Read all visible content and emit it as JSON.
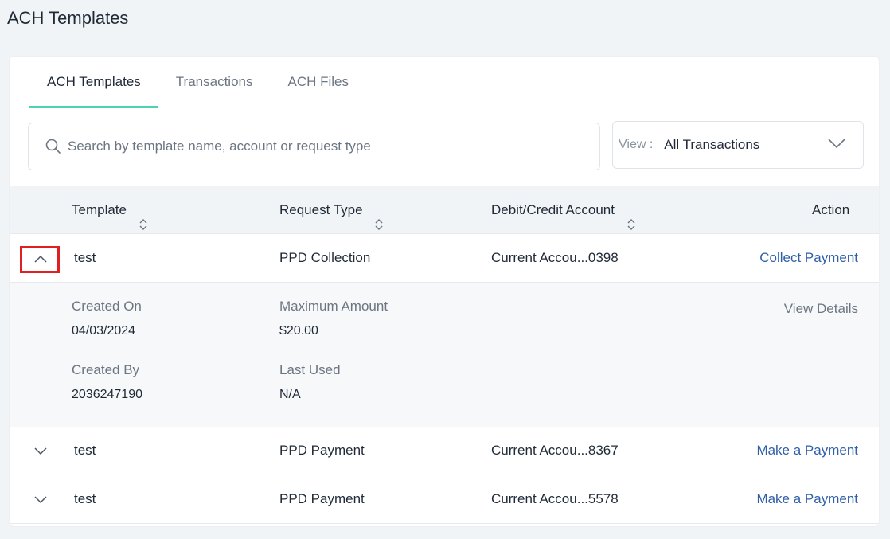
{
  "page": {
    "title": "ACH Templates"
  },
  "tabs": [
    {
      "label": "ACH Templates",
      "active": true
    },
    {
      "label": "Transactions",
      "active": false
    },
    {
      "label": "ACH Files",
      "active": false
    }
  ],
  "search": {
    "placeholder": "Search by template name, account or request type",
    "value": ""
  },
  "view": {
    "label": "View :",
    "value": "All Transactions"
  },
  "table": {
    "columns": {
      "template": "Template",
      "request_type": "Request Type",
      "account": "Debit/Credit Account",
      "action": "Action"
    },
    "rows": [
      {
        "template": "test",
        "request_type": "PPD Collection",
        "account": "Current Accou...0398",
        "action": "Collect Payment",
        "expanded": true
      },
      {
        "template": "test",
        "request_type": "PPD Payment",
        "account": "Current Accou...8367",
        "action": "Make a Payment",
        "expanded": false
      },
      {
        "template": "test",
        "request_type": "PPD Payment",
        "account": "Current Accou...5578",
        "action": "Make a Payment",
        "expanded": false
      }
    ],
    "detail": {
      "created_on_label": "Created On",
      "created_on": "04/03/2024",
      "created_by_label": "Created By",
      "created_by": "2036247190",
      "max_amount_label": "Maximum Amount",
      "max_amount": "$20.00",
      "last_used_label": "Last Used",
      "last_used": "N/A",
      "view_details": "View Details"
    }
  },
  "colors": {
    "accent_tab": "#4fd1b5",
    "link": "#2f5fa8",
    "highlight": "#e02020"
  },
  "icons": {
    "search": "search-icon",
    "view_chevron": "chevron-down-icon",
    "sort": "sort-icon",
    "row_collapse": "chevron-up-icon",
    "row_expand": "chevron-down-icon"
  }
}
